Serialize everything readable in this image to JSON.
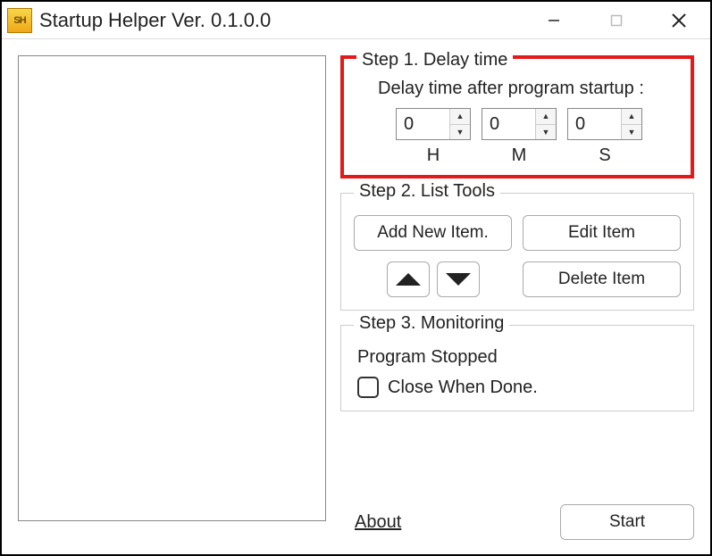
{
  "titlebar": {
    "app_icon_text": "SH",
    "title": "Startup Helper   Ver. 0.1.0.0"
  },
  "step1": {
    "legend": "Step 1. Delay time",
    "label": "Delay time after program startup :",
    "h_value": "0",
    "m_value": "0",
    "s_value": "0",
    "h_caption": "H",
    "m_caption": "M",
    "s_caption": "S"
  },
  "step2": {
    "legend": "Step 2. List Tools",
    "add_label": "Add New Item.",
    "edit_label": "Edit Item",
    "delete_label": "Delete Item"
  },
  "step3": {
    "legend": "Step 3. Monitoring",
    "status": "Program Stopped",
    "checkbox_label": "Close When Done."
  },
  "footer": {
    "about_label": "About",
    "start_label": "Start"
  }
}
